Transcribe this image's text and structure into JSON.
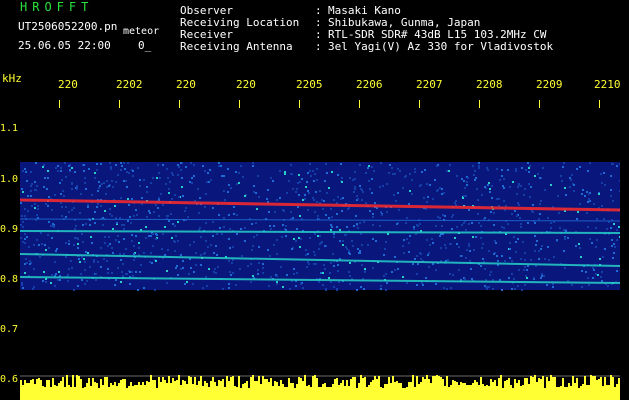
{
  "header": {
    "brand": "HROFFT",
    "filename": "UT2506052200.pn",
    "kind": "meteor",
    "datetime": "25.06.05 22:00",
    "duration": "0_"
  },
  "info": [
    {
      "key": "Observer",
      "sep": ":",
      "value": "Masaki Kano"
    },
    {
      "key": "Receiving Location",
      "sep": ":",
      "value": "Shibukawa, Gunma, Japan"
    },
    {
      "key": "Receiver",
      "sep": ":",
      "value": "RTL-SDR SDR# 43dB L15 103.2MHz CW"
    },
    {
      "key": "Receiving Antenna",
      "sep": ":",
      "value": "3el Yagi(V) Az 330 for Vladivostok"
    }
  ],
  "axis": {
    "unit": "kHz",
    "y_ticks": [
      "1.1",
      "1.0",
      "0.9",
      "0.8",
      "0.7",
      "0.6"
    ],
    "x_ticks": [
      "220",
      "2202",
      "220",
      "220",
      "2205",
      "2206",
      "2207",
      "2208",
      "2209",
      "2210"
    ]
  },
  "colors": {
    "background": "#000000",
    "text_header": "#27e23a",
    "text_info": "#ffffff",
    "axis": "#ffff33",
    "spectrum_low": "#0a1a8a",
    "spectrum_mid": "#1e6bd6",
    "spectrum_high": "#26d0c8",
    "spectrum_peak": "#ff2a2a"
  }
}
